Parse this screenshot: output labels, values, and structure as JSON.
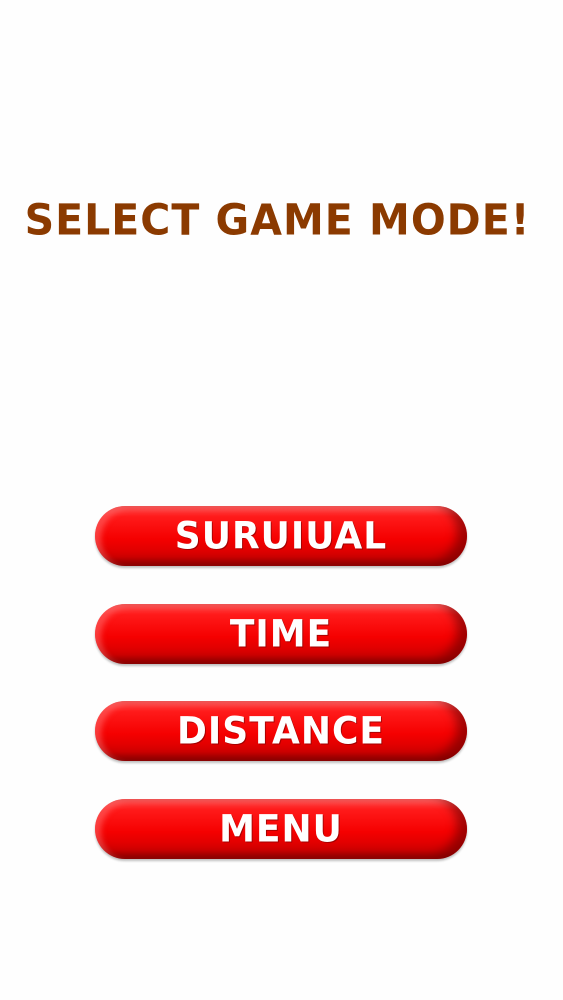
{
  "screen": {
    "title": "SELECT GAME MODE!"
  },
  "buttons": {
    "survival_label": "SURUIUAL",
    "time_label": "TIME",
    "distance_label": "DISTANCE",
    "menu_label": "MENU"
  },
  "colors": {
    "background": "#fefefe",
    "title": "#8b3a00",
    "button": "#f50000",
    "button_text": "#ffffff"
  }
}
